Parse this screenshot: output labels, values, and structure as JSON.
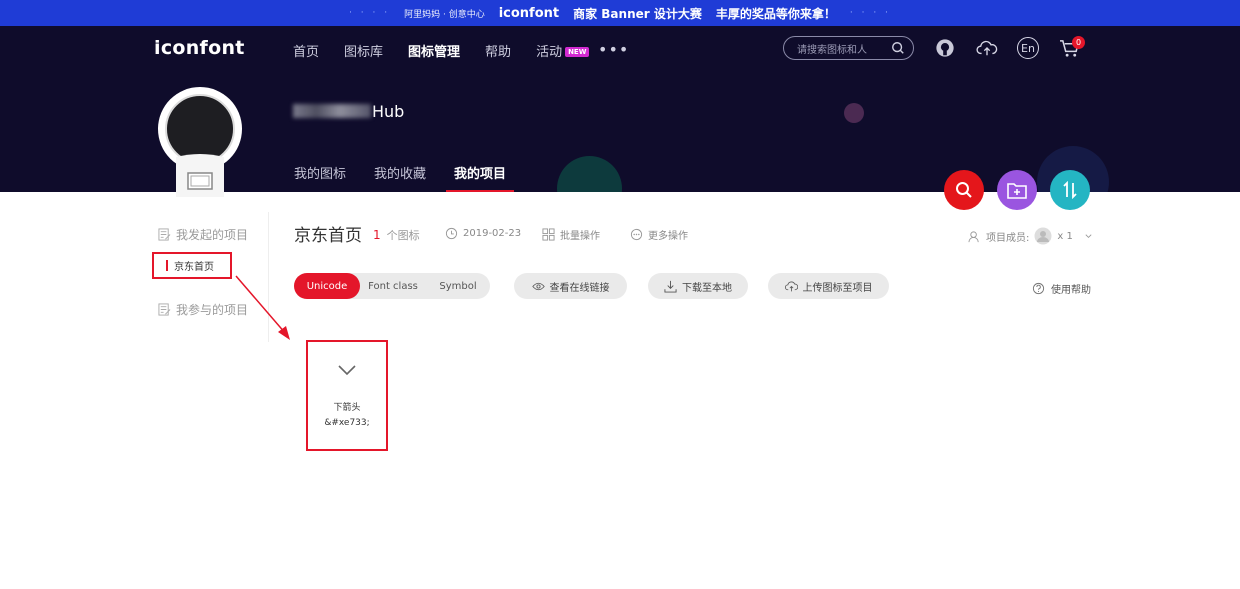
{
  "promo": {
    "org": "阿里妈妈 · 创意中心",
    "brand": "iconfont",
    "headline": "商家 Banner 设计大赛",
    "tagline": "丰厚的奖品等你来拿！"
  },
  "header": {
    "logo": "iconfont",
    "nav": [
      "首页",
      "图标库",
      "图标管理",
      "帮助",
      "活动"
    ],
    "nav_new_badge": "NEW",
    "search_placeholder": "请搜索图标和人",
    "lang": "En",
    "cart_count": "0"
  },
  "profile": {
    "username_visible": "Hub",
    "tabs": [
      "我的图标",
      "我的收藏",
      "我的项目"
    ]
  },
  "sidebar": {
    "initiated": "我发起的项目",
    "active_project": "京东首页",
    "joined": "我参与的项目"
  },
  "project": {
    "name": "京东首页",
    "icon_count": "1",
    "icon_count_unit": "个图标",
    "date": "2019-02-23",
    "batch": "批量操作",
    "more": "更多操作",
    "members_label": "项目成员:",
    "members_count": "x 1"
  },
  "toolbar": {
    "formats": [
      "Unicode",
      "Font class",
      "Symbol"
    ],
    "view_link": "查看在线链接",
    "download": "下载至本地",
    "upload": "上传图标至项目",
    "help": "使用帮助"
  },
  "icons": [
    {
      "name": "下箭头",
      "code": "&#xe733;"
    }
  ],
  "colors": {
    "accent": "#e4162a",
    "header_bg": "#0f0c2b",
    "promo_bg": "#1f3cd6",
    "fab_search": "#e4161b",
    "fab_folder": "#9a55e0",
    "fab_sort": "#24b5c3"
  }
}
